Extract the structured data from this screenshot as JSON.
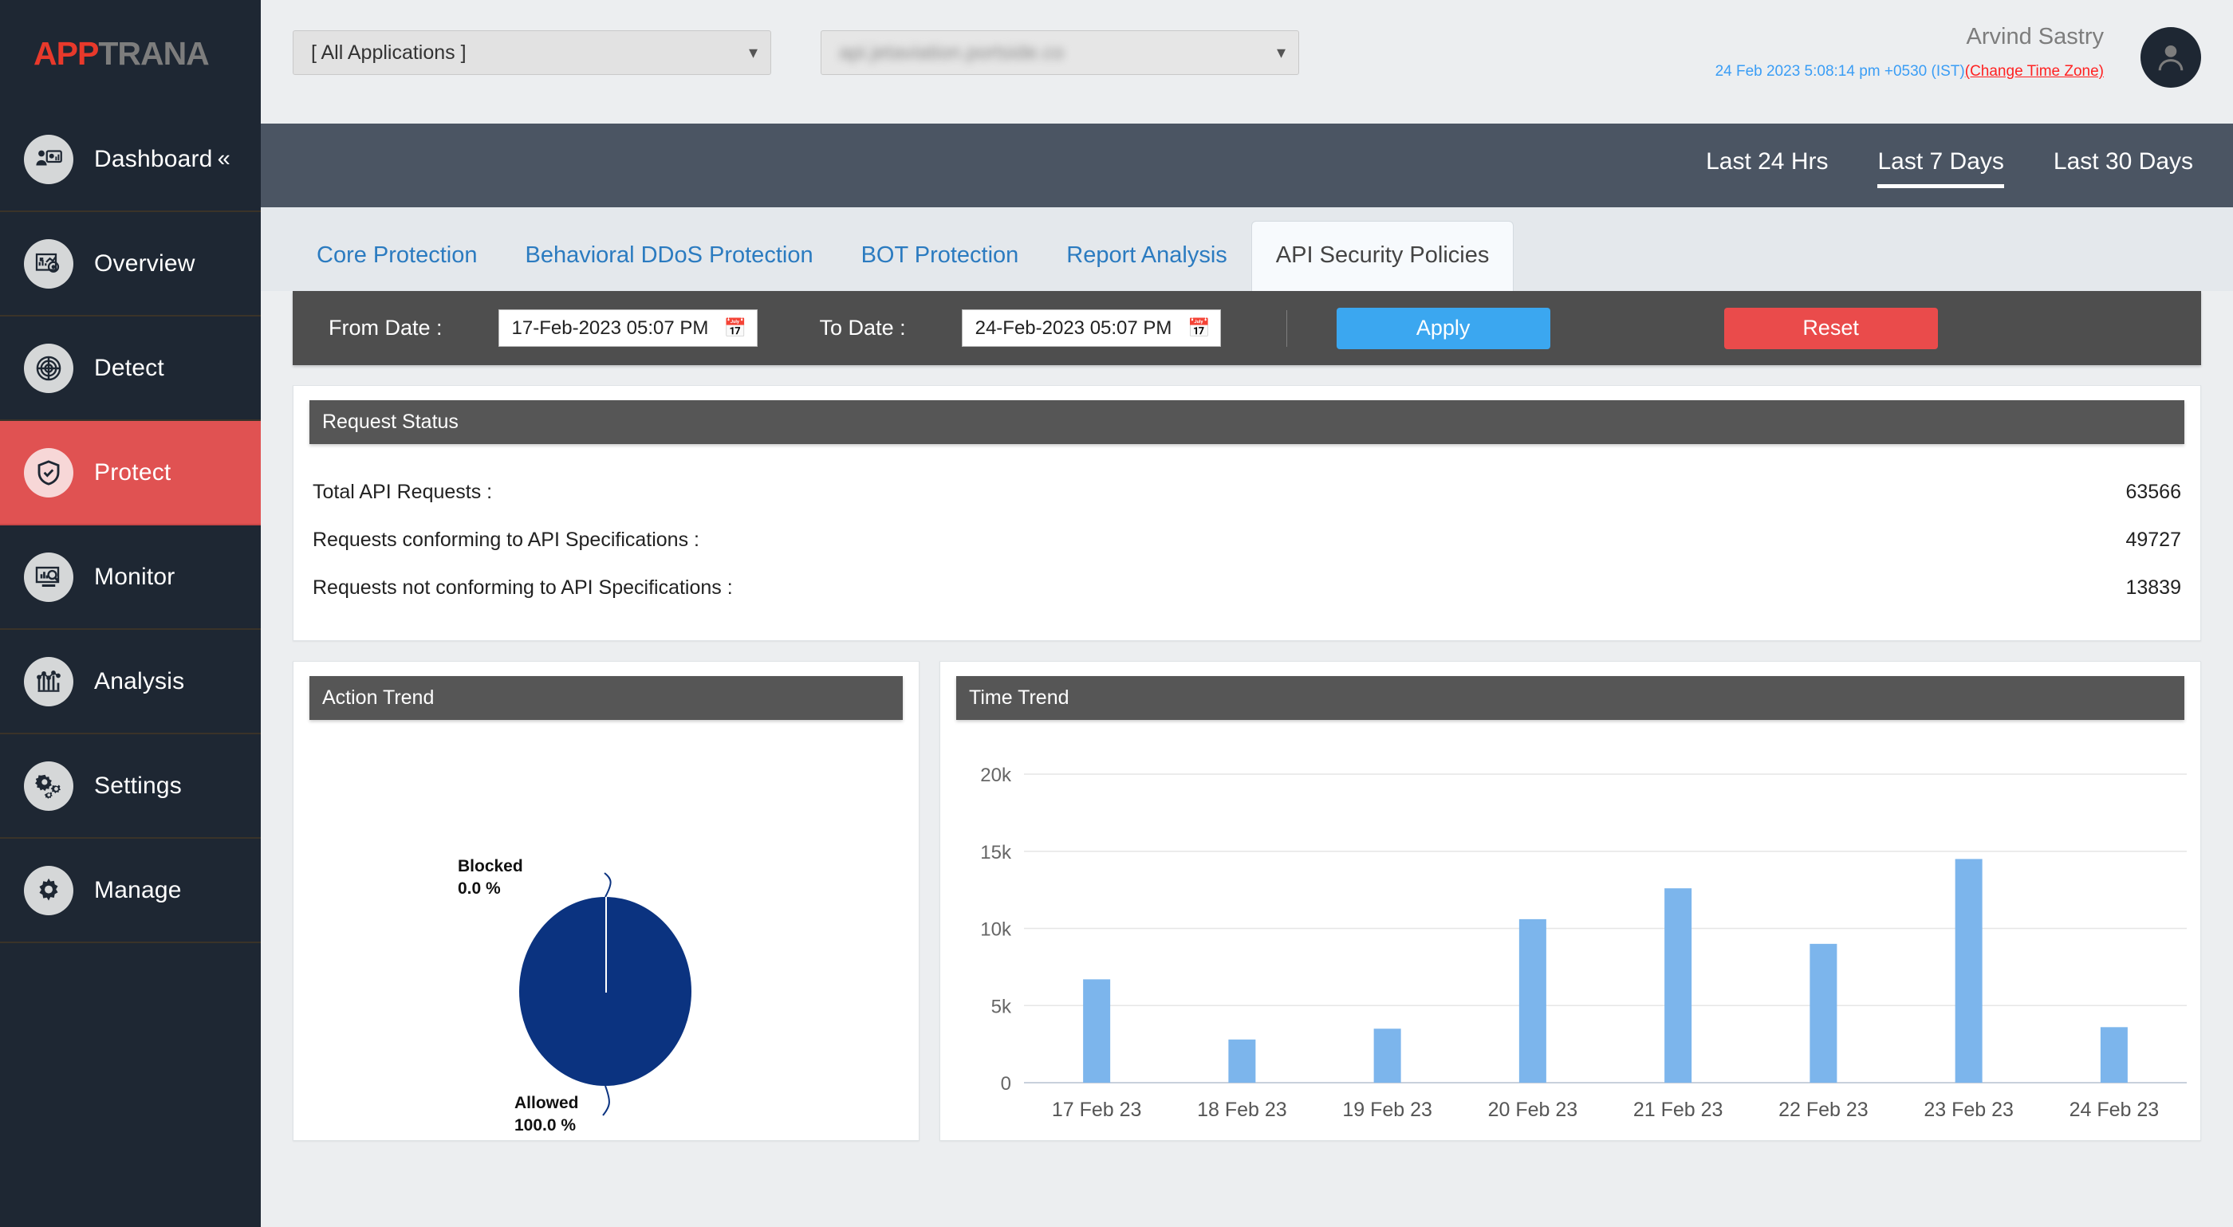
{
  "brand": {
    "name_part1": "APP",
    "name_part2": "TRANA"
  },
  "sidebar": {
    "items": [
      {
        "label": "Dashboard",
        "icon": "dashboard-presenter-icon",
        "active": false,
        "collapse": "«"
      },
      {
        "label": "Overview",
        "icon": "report-chart-icon",
        "active": false
      },
      {
        "label": "Detect",
        "icon": "radar-target-icon",
        "active": false
      },
      {
        "label": "Protect",
        "icon": "shield-check-icon",
        "active": true
      },
      {
        "label": "Monitor",
        "icon": "monitor-search-icon",
        "active": false
      },
      {
        "label": "Analysis",
        "icon": "bar-line-chart-icon",
        "active": false
      },
      {
        "label": "Settings",
        "icon": "gears-icon",
        "active": false
      },
      {
        "label": "Manage",
        "icon": "gear-icon",
        "active": false
      }
    ]
  },
  "topbar": {
    "app_select_value": "[ All Applications ]",
    "site_select_value": "api.jetaviation.portside.co",
    "user_name": "Arvind Sastry",
    "timestamp": "24 Feb 2023 5:08:14 pm +0530 (IST)",
    "timezone_link": "(Change Time Zone)",
    "avatar_icon": "user-avatar-icon",
    "caret_icon": "chevron-down-icon"
  },
  "range_tabs": [
    {
      "label": "Last 24 Hrs",
      "active": false
    },
    {
      "label": "Last 7 Days",
      "active": true
    },
    {
      "label": "Last 30 Days",
      "active": false
    }
  ],
  "tabs": [
    {
      "label": "Core Protection",
      "active": false
    },
    {
      "label": "Behavioral DDoS Protection",
      "active": false
    },
    {
      "label": "BOT Protection",
      "active": false
    },
    {
      "label": "Report Analysis",
      "active": false
    },
    {
      "label": "API Security Policies",
      "active": true
    }
  ],
  "date_filter": {
    "from_label": "From Date :",
    "from_value": "17-Feb-2023 05:07 PM",
    "to_label": "To Date :",
    "to_value": "24-Feb-2023 05:07 PM",
    "calendar_icon": "calendar-icon",
    "apply_label": "Apply",
    "reset_label": "Reset"
  },
  "request_status": {
    "title": "Request Status",
    "rows": [
      {
        "label": "Total API Requests :",
        "value": "63566"
      },
      {
        "label": "Requests conforming to API Specifications :",
        "value": "49727"
      },
      {
        "label": "Requests not conforming to API Specifications :",
        "value": "13839"
      }
    ]
  },
  "action_trend": {
    "title": "Action Trend"
  },
  "time_trend": {
    "title": "Time Trend"
  },
  "colors": {
    "accent_red": "#e05252",
    "brand_red": "#e8392b",
    "link_blue": "#2b7bc0",
    "apply_blue": "#3ba7f0",
    "reset_red": "#ea4b4b",
    "sidebar_bg": "#1e2733",
    "pie_navy": "#0b3380",
    "bar_blue": "#7cb5ec"
  },
  "chart_data": [
    {
      "type": "pie",
      "title": "Action Trend",
      "labels": [
        "Blocked",
        "Allowed"
      ],
      "values": [
        0.0,
        100.0
      ],
      "value_labels": [
        "0.0 %",
        "100.0 %"
      ],
      "colors": [
        "#ffffff",
        "#0b3380"
      ],
      "legend": "none",
      "unit": "%"
    },
    {
      "type": "bar",
      "title": "Time Trend",
      "categories": [
        "17 Feb 23",
        "18 Feb 23",
        "19 Feb 23",
        "20 Feb 23",
        "21 Feb 23",
        "22 Feb 23",
        "23 Feb 23",
        "24 Feb 23"
      ],
      "values": [
        6700,
        2800,
        3500,
        10600,
        12600,
        9000,
        14500,
        3600
      ],
      "ylim": [
        0,
        20000
      ],
      "yticks": [
        0,
        5000,
        10000,
        15000,
        20000
      ],
      "ytick_labels": [
        "0",
        "5k",
        "10k",
        "15k",
        "20k"
      ],
      "xlabel": "",
      "ylabel": "",
      "grid": true,
      "legend": "none",
      "color": "#7cb5ec"
    }
  ]
}
